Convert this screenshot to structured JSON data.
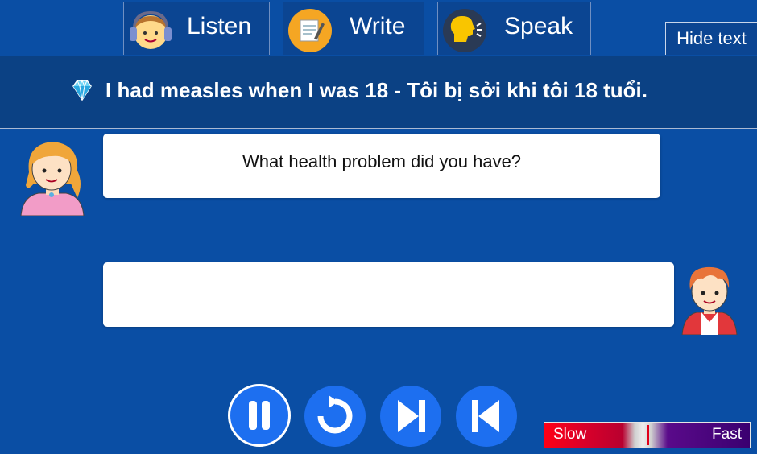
{
  "tabs": {
    "listen": {
      "label": "Listen",
      "icon": "headphones-child-icon"
    },
    "write": {
      "label": "Write",
      "icon": "notepad-pencil-icon"
    },
    "speak": {
      "label": "Speak",
      "icon": "speaking-head-icon"
    }
  },
  "hide_text_label": "Hide text",
  "sentence": {
    "icon": "diamond-icon",
    "text": "I had measles when I was 18 - Tôi bị sởi khi tôi 18 tuổi."
  },
  "dialogue": {
    "question": "What health problem did you have?",
    "answer": ""
  },
  "controls": {
    "pause_icon": "pause-icon",
    "replay_icon": "replay-icon",
    "next_icon": "skip-next-icon",
    "previous_icon": "skip-previous-icon"
  },
  "speed": {
    "slow_label": "Slow",
    "fast_label": "Fast",
    "level": 0.5
  },
  "colors": {
    "background": "#0a4ea4",
    "tab_background": "#0b4592",
    "sentence_bar": "#0b4184",
    "button_blue": "#1d6ff0",
    "slow_red": "#ff0016",
    "fast_purple": "#3a0070"
  }
}
